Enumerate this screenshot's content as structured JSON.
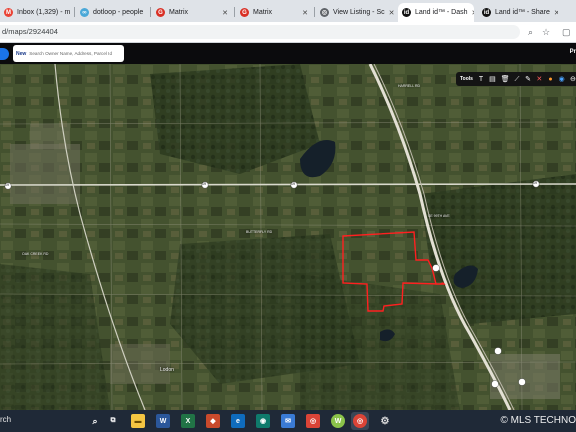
{
  "browser": {
    "tabs": [
      {
        "label": "Inbox (1,329) - m",
        "icon": "gmail-icon",
        "color": "#ea4335",
        "glyph": "M"
      },
      {
        "label": "dotloop - people",
        "icon": "dotloop-icon",
        "color": "#4aa8d8",
        "glyph": "∞"
      },
      {
        "label": "Matrix",
        "icon": "matrix-icon",
        "color": "#d93025",
        "glyph": "G"
      },
      {
        "label": "Matrix",
        "icon": "matrix-icon",
        "color": "#d93025",
        "glyph": "G"
      },
      {
        "label": "View Listing - Sc",
        "icon": "globe-icon",
        "color": "#5f6368",
        "glyph": "◎"
      },
      {
        "label": "Land id™ - Dash",
        "icon": "landid-icon",
        "color": "#111111",
        "glyph": "id",
        "active": true
      },
      {
        "label": "Land id™ - Share",
        "icon": "landid-icon",
        "color": "#111111",
        "glyph": "id"
      }
    ],
    "url": "d/maps/2924404"
  },
  "app": {
    "new_label": "New",
    "search_placeholder": "Search Owner Name, Address, Parcel Id",
    "right_label": "Pr"
  },
  "toolbar": {
    "label": "Tools",
    "tools": [
      {
        "name": "text-tool-icon",
        "glyph": "T"
      },
      {
        "name": "note-tool-icon",
        "glyph": "▤"
      },
      {
        "name": "delete-tool-icon",
        "glyph": "🗑"
      },
      {
        "name": "measure-tool-icon",
        "glyph": "⟋"
      },
      {
        "name": "draw-tool-icon",
        "glyph": "✎"
      },
      {
        "name": "close-tool-icon",
        "glyph": "✕"
      },
      {
        "name": "color-tool-icon",
        "glyph": "●"
      },
      {
        "name": "layers-tool-icon",
        "glyph": "◉"
      },
      {
        "name": "print-tool-icon",
        "glyph": "⊖"
      }
    ]
  },
  "map": {
    "place_label": "Lodon",
    "route_shields": [
      "19",
      "19",
      "19",
      "19"
    ],
    "road_labels": [
      "HARRELL RD",
      "SE 99TH AVE",
      "BUTTERFLY RD",
      "OAK CREEK RD"
    ],
    "parcel_color": "#ff2020"
  },
  "taskbar": {
    "search_text": "rch",
    "watermark": "© MLS TECHNO"
  }
}
